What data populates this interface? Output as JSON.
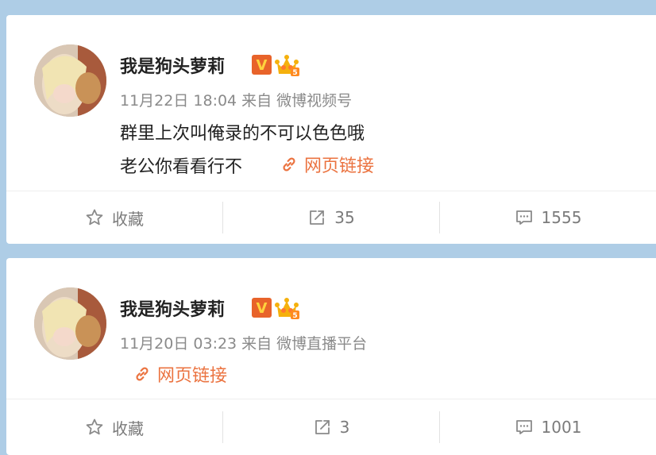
{
  "posts": [
    {
      "username": "我是狗头萝莉",
      "date": "11月22日 18:04",
      "source_prefix": "来自",
      "source": "微博视频号",
      "lines": [
        "群里上次叫俺录的不可以色色哦",
        "老公你看看行不"
      ],
      "link_label": "网页链接",
      "actions": {
        "favorite_label": "收藏",
        "repost_count": "35",
        "comment_count": "1555"
      }
    },
    {
      "username": "我是狗头萝莉",
      "date": "11月20日 03:23",
      "source_prefix": "来自",
      "source": "微博直播平台",
      "lines": [],
      "link_label": "网页链接",
      "actions": {
        "favorite_label": "收藏",
        "repost_count": "3",
        "comment_count": "1001"
      }
    }
  ],
  "badges": {
    "verified": "V",
    "level": "5"
  },
  "colors": {
    "background": "#aecde6",
    "link": "#eb7340",
    "verified": "#e8632a",
    "text": "#222222",
    "meta": "#8a8a8a"
  },
  "icons": [
    "link-icon",
    "star-icon",
    "repost-icon",
    "comment-icon",
    "verified-badge-icon",
    "crown-badge-icon"
  ]
}
